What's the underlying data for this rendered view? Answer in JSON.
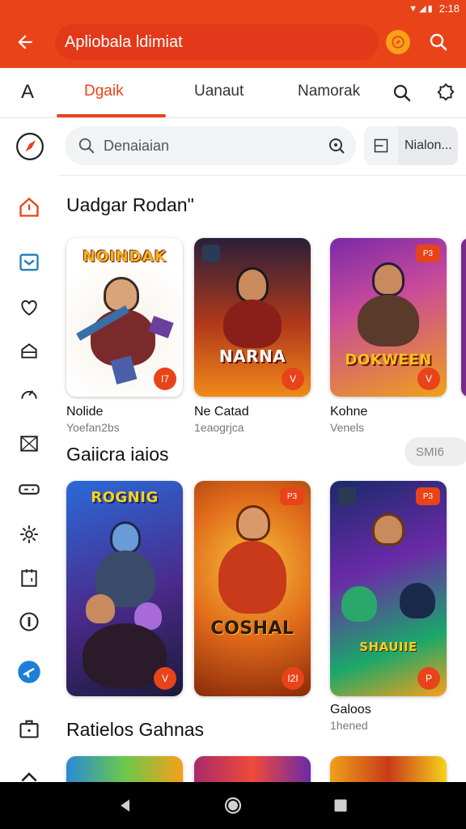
{
  "status_bar": {
    "time": "2:18"
  },
  "app_bar": {
    "title": "Apliobala ldimiat"
  },
  "tabs": [
    {
      "label": "Dgaik",
      "active": true
    },
    {
      "label": "Uanaut",
      "active": false
    },
    {
      "label": "Namorak",
      "active": false
    }
  ],
  "tab_a_label": "A",
  "search": {
    "placeholder": "Denaiaian"
  },
  "chip": {
    "label": "Nialon..."
  },
  "sections": [
    {
      "title": "Uadgar Rodan\""
    },
    {
      "title": "Gaiicra iaios",
      "more_label": "SMI6"
    },
    {
      "title": "Ratielos Gahnas"
    }
  ],
  "row1": [
    {
      "title": "Nolide",
      "subtitle": "Yoefan2bs",
      "art_text": "NOINDAK",
      "badge": "I7"
    },
    {
      "title": "Ne Catad",
      "subtitle": "1eaogrjca",
      "art_text": "NARNA",
      "badge": "V"
    },
    {
      "title": "Kohne",
      "subtitle": "Venels",
      "art_text": "DOKWEEN",
      "badge": "V",
      "tag": "P3"
    }
  ],
  "row2": [
    {
      "title": "",
      "subtitle": "",
      "art_text": "ROGNIG",
      "badge": "V"
    },
    {
      "title": "",
      "subtitle": "",
      "art_text": "COSHAL",
      "badge": "I2I",
      "tag": "P3"
    },
    {
      "title": "Galoos",
      "subtitle": "1hened",
      "art_text": "SHAUIIE",
      "badge": "P",
      "tag": "P3"
    }
  ],
  "colors": {
    "accent": "#e9431a",
    "background": "#ffffff"
  }
}
